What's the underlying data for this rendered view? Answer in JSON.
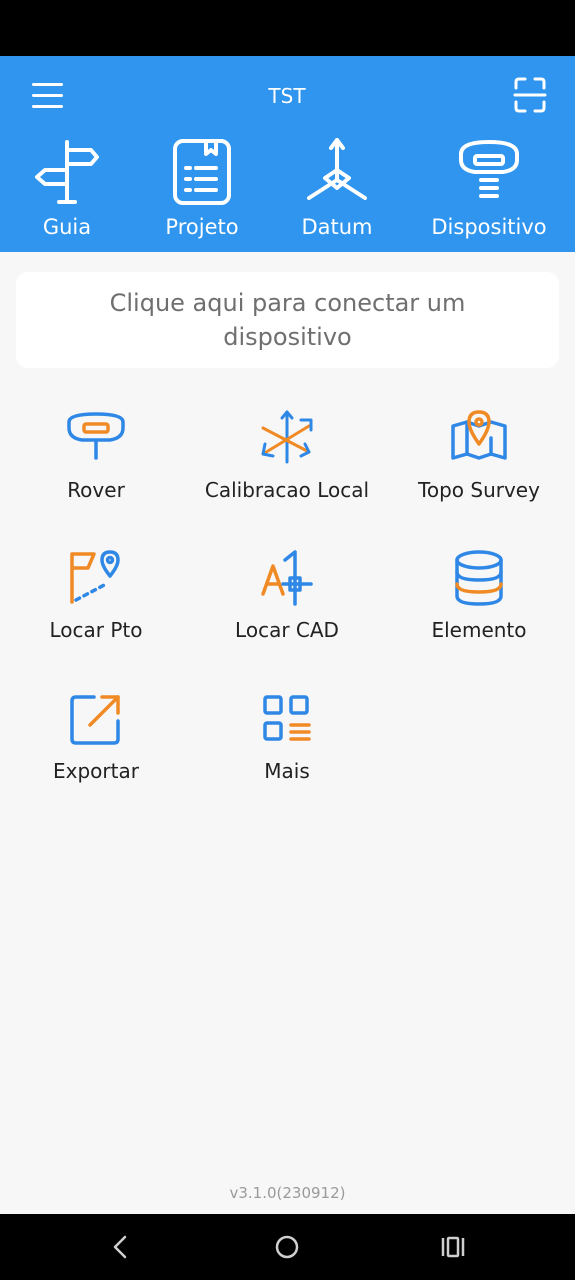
{
  "header": {
    "title": "TST",
    "menu_icon": "hamburger-menu-icon",
    "scan_icon": "scan-icon",
    "background": "#2f95ee"
  },
  "top_nav": [
    {
      "label": "Guia",
      "icon": "signpost-icon"
    },
    {
      "label": "Projeto",
      "icon": "project-document-icon"
    },
    {
      "label": "Datum",
      "icon": "datum-axes-icon"
    },
    {
      "label": "Dispositivo",
      "icon": "gnss-receiver-icon"
    }
  ],
  "connect_card": {
    "text": "Clique aqui para conectar um dispositivo"
  },
  "tiles": [
    {
      "label": "Rover",
      "icon": "rover-receiver-icon"
    },
    {
      "label": "Calibracao Local",
      "icon": "local-calibration-icon"
    },
    {
      "label": "Topo Survey",
      "icon": "map-pin-icon"
    },
    {
      "label": "Locar Pto",
      "icon": "stakeout-point-icon"
    },
    {
      "label": "Locar CAD",
      "icon": "stakeout-cad-icon"
    },
    {
      "label": "Elemento",
      "icon": "database-icon"
    },
    {
      "label": "Exportar",
      "icon": "export-icon"
    },
    {
      "label": "Mais",
      "icon": "more-grid-icon"
    }
  ],
  "version": "v3.1.0(230912)",
  "colors": {
    "accent_blue": "#2f87e6",
    "accent_orange": "#f08a24"
  }
}
